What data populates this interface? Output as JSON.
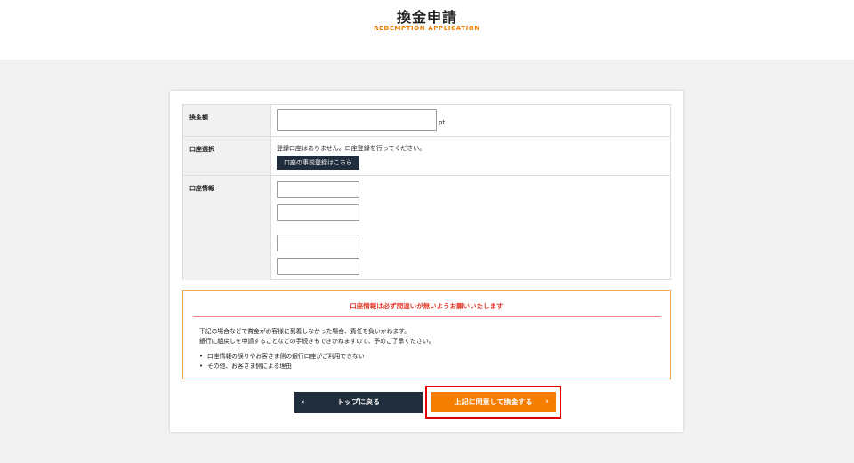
{
  "header": {
    "title": "換金申請",
    "subtitle": "REDEMPTION APPLICATION"
  },
  "form": {
    "amount": {
      "label": "換金額",
      "value": "",
      "unit": "pt"
    },
    "account_select": {
      "label": "口座選択",
      "message": "登録口座はありません。口座登録を行ってください。",
      "register_button": "口座の事前登録はこちら"
    },
    "account_info": {
      "label": "口座情報",
      "fields": [
        "",
        "",
        "",
        ""
      ]
    }
  },
  "notice": {
    "title": "口座情報は必ず間違いが無いようお願いいたします",
    "lines": [
      "下記の場合などで賞金がお客様に到着しなかった場合、責任を負いかねます。",
      "銀行に組戻しを申請することなどの手続きもできかねますので、予めご了承ください。"
    ],
    "bullets": [
      "口座情報の誤りやお客さま側の銀行口座がご利用できない",
      "その他、お客さま側による理由"
    ]
  },
  "actions": {
    "back_label": "トップに戻る",
    "agree_label": "上記に同意して換金する"
  },
  "colors": {
    "accent": "#f57d00",
    "navy": "#1f2d3d",
    "notice_border": "#f3a35a",
    "notice_title": "#e6392a",
    "highlight": "#e30000"
  },
  "icons": {
    "back": "chevron-left-icon",
    "forward": "chevron-right-icon"
  }
}
